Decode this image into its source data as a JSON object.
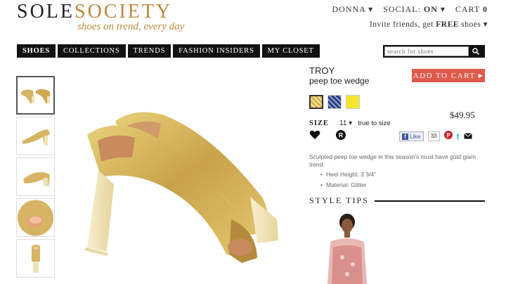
{
  "header": {
    "logo_sole": "SOLE",
    "logo_society": "SOCIETY",
    "tagline": "shoes on trend, every day",
    "user": "DONNA ▾",
    "social_label": "SOCIAL:",
    "social_state": "ON",
    "social_arrow": "▾",
    "cart_label": "CART",
    "cart_count": "0",
    "invite_prefix": "Invite friends, get",
    "invite_free": "FREE",
    "invite_suffix": "shoes ▾"
  },
  "nav": {
    "items": [
      "SHOES",
      "COLLECTIONS",
      "TRENDS",
      "FASHION INSIDERS",
      "MY CLOSET"
    ]
  },
  "search": {
    "placeholder": "search for shoes"
  },
  "product": {
    "name": "TROY",
    "subtitle": "peep toe wedge",
    "add_to_cart": "ADD TO CART",
    "price": "$49.95",
    "size_label": "SIZE",
    "size_value": "11 ▾",
    "size_fit": "true to size",
    "description": "Sculpted peep toe wedge in this season's must have gold glam trend.",
    "details": [
      "Heel Height: 3 3/4\"",
      "Material: Glitter"
    ],
    "swatch_colors": [
      "#d9b24a",
      "#2c3f7a",
      "#f4e630"
    ],
    "fb_like": "Like",
    "fb_count": "33"
  },
  "style_tips": {
    "title": "STYLE TIPS"
  },
  "colors": {
    "gold": "#b9893c",
    "add_to_cart": "#e05a4a"
  }
}
